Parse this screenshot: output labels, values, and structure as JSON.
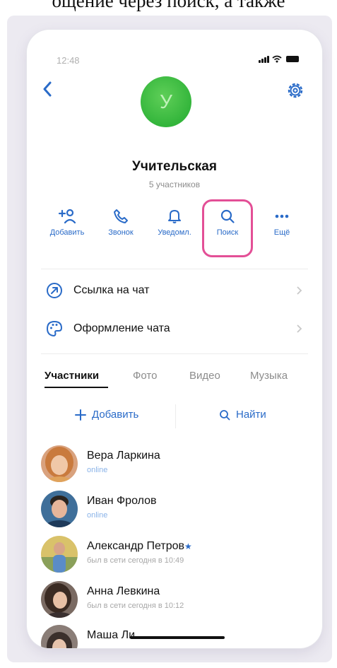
{
  "caption": "ощение через поиск, а также",
  "status": {
    "time": "12:48"
  },
  "chat": {
    "avatar_letter": "У",
    "title": "Учительская",
    "subtitle": "5 участников"
  },
  "actions": [
    {
      "label": "Добавить",
      "icon": "add-user-icon"
    },
    {
      "label": "Звонок",
      "icon": "phone-icon"
    },
    {
      "label": "Уведомл.",
      "icon": "bell-icon"
    },
    {
      "label": "Поиск",
      "icon": "search-icon",
      "highlighted": true
    },
    {
      "label": "Ещё",
      "icon": "more-icon"
    }
  ],
  "menu": [
    {
      "label": "Ссылка на чат",
      "icon": "link-arrow-icon"
    },
    {
      "label": "Оформление чата",
      "icon": "palette-icon"
    }
  ],
  "tabs": [
    "Участники",
    "Фото",
    "Видео",
    "Музыка"
  ],
  "active_tab": "Участники",
  "member_tools": {
    "add": "Добавить",
    "find": "Найти"
  },
  "members": [
    {
      "name": "Вера Ларкина",
      "status": "online"
    },
    {
      "name": "Иван Фролов",
      "status": "online"
    },
    {
      "name": "Александр Петров",
      "status": "был в сети сегодня в 10:49",
      "star": "★"
    },
    {
      "name": "Анна Левкина",
      "status": "был в сети сегодня в 10:12"
    },
    {
      "name": "Маша Ли",
      "status": ""
    }
  ],
  "colors": {
    "accent": "#2a6bc8",
    "highlight": "#e34f96",
    "avatar_green": "#33b53b"
  }
}
